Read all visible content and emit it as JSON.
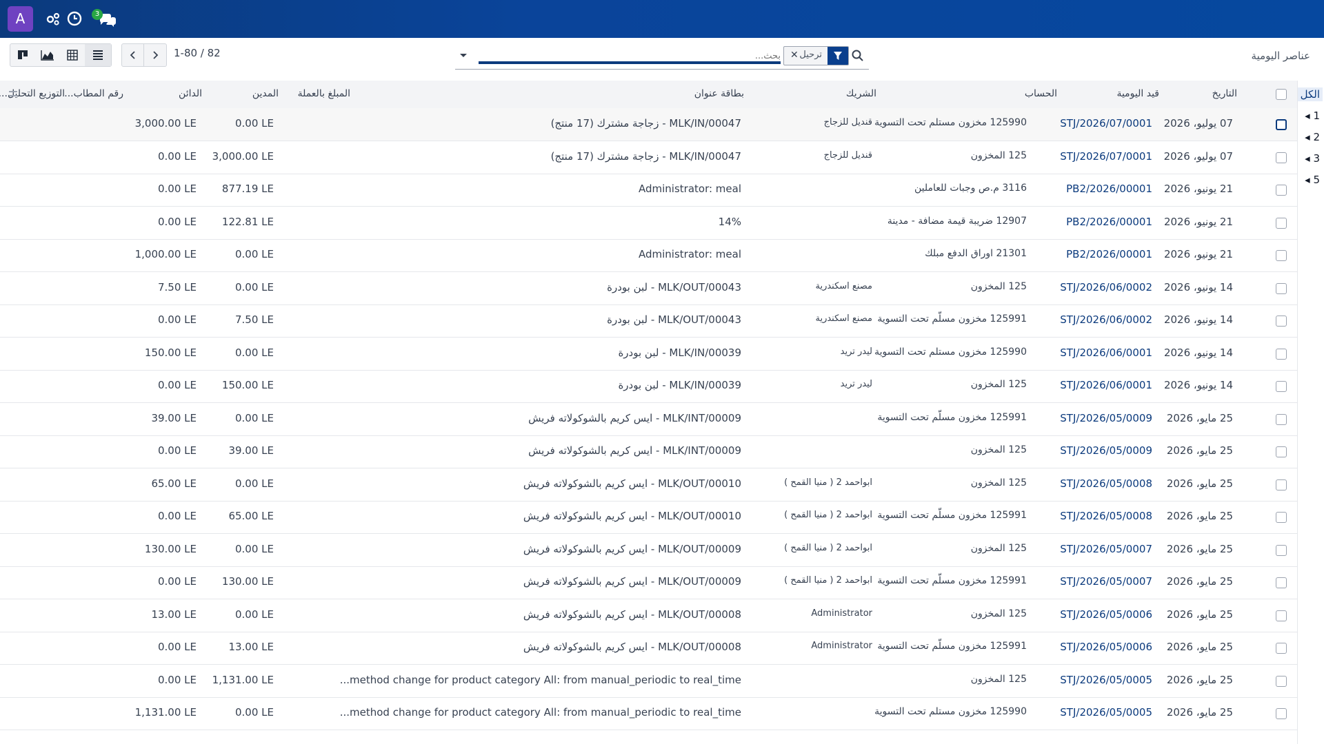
{
  "navbar": {
    "avatar_letter": "A",
    "icons": [
      "users-cog-icon",
      "clock-icon",
      "chat-icon"
    ],
    "chat_badge": "3"
  },
  "breadcrumb": "عناصر اليومية",
  "search": {
    "placeholder": "بحث...",
    "facet_value": "ترحيل"
  },
  "pager": {
    "value": "1-80 / 82"
  },
  "side_panel": {
    "items": [
      "الكل",
      "1",
      "2",
      "3",
      "5"
    ]
  },
  "table": {
    "headers": {
      "date": "التاريخ",
      "journal_entry": "قيد اليومية",
      "account": "الحساب",
      "partner": "الشريك",
      "label": "بطاقة عنوان",
      "amount_currency": "المبلغ بالعملة",
      "debit": "المدين",
      "credit": "الدائن",
      "matching": "رقم المطاب...",
      "analytic": "التوزيع التحليل..."
    },
    "rows": [
      {
        "date": "07 يوليو، 2026",
        "entry": "STJ/2026/07/0001",
        "account": "125990 مخزون مستلم تحت التسوية",
        "partner": "قنديل للزجاج",
        "label": "MLK/IN/00047 - زجاجة مشترك (17 منتج)",
        "debit": "0.00 LE",
        "credit": "3,000.00 LE"
      },
      {
        "date": "07 يوليو، 2026",
        "entry": "STJ/2026/07/0001",
        "account": "125 المخزون",
        "partner": "قنديل للزجاج",
        "label": "MLK/IN/00047 - زجاجة مشترك (17 منتج)",
        "debit": "3,000.00 LE",
        "credit": "0.00 LE"
      },
      {
        "date": "21 يونيو، 2026",
        "entry": "PB2/2026/00001",
        "account": "3116 م.ص وجبات للعاملين",
        "partner": "",
        "label": "Administrator: meal",
        "debit": "877.19 LE",
        "credit": "0.00 LE"
      },
      {
        "date": "21 يونيو، 2026",
        "entry": "PB2/2026/00001",
        "account": "12907 ضريبة قيمة مضافة - مدينة",
        "partner": "",
        "label": "14%",
        "debit": "122.81 LE",
        "credit": "0.00 LE"
      },
      {
        "date": "21 يونيو، 2026",
        "entry": "PB2/2026/00001",
        "account": "21301 اوراق الدفع مبلك",
        "partner": "",
        "label": "Administrator: meal",
        "debit": "0.00 LE",
        "credit": "1,000.00 LE"
      },
      {
        "date": "14 يونيو، 2026",
        "entry": "STJ/2026/06/0002",
        "account": "125 المخزون",
        "partner": "مصنع اسكندرية",
        "label": "MLK/OUT/00043 - لبن بودرة",
        "debit": "0.00 LE",
        "credit": "7.50 LE"
      },
      {
        "date": "14 يونيو، 2026",
        "entry": "STJ/2026/06/0002",
        "account": "125991 مخزون مسلّم تحت التسوية",
        "partner": "مصنع اسكندرية",
        "label": "MLK/OUT/00043 - لبن بودرة",
        "debit": "7.50 LE",
        "credit": "0.00 LE"
      },
      {
        "date": "14 يونيو، 2026",
        "entry": "STJ/2026/06/0001",
        "account": "125990 مخزون مستلم تحت التسوية",
        "partner": "ليدر تريد",
        "label": "MLK/IN/00039 - لبن بودرة",
        "debit": "0.00 LE",
        "credit": "150.00 LE"
      },
      {
        "date": "14 يونيو، 2026",
        "entry": "STJ/2026/06/0001",
        "account": "125 المخزون",
        "partner": "ليدر تريد",
        "label": "MLK/IN/00039 - لبن بودرة",
        "debit": "150.00 LE",
        "credit": "0.00 LE"
      },
      {
        "date": "25 مايو، 2026",
        "entry": "STJ/2026/05/0009",
        "account": "125991 مخزون مسلّم تحت التسوية",
        "partner": "",
        "label": "MLK/INT/00009 - ايس كريم بالشوكولاته فريش",
        "debit": "0.00 LE",
        "credit": "39.00 LE"
      },
      {
        "date": "25 مايو، 2026",
        "entry": "STJ/2026/05/0009",
        "account": "125 المخزون",
        "partner": "",
        "label": "MLK/INT/00009 - ايس كريم بالشوكولاته فريش",
        "debit": "39.00 LE",
        "credit": "0.00 LE"
      },
      {
        "date": "25 مايو، 2026",
        "entry": "STJ/2026/05/0008",
        "account": "125 المخزون",
        "partner": "ابواحمد 2 ( منيا القمح )",
        "label": "MLK/OUT/00010 - ايس كريم بالشوكولاته فريش",
        "debit": "0.00 LE",
        "credit": "65.00 LE"
      },
      {
        "date": "25 مايو، 2026",
        "entry": "STJ/2026/05/0008",
        "account": "125991 مخزون مسلّم تحت التسوية",
        "partner": "ابواحمد 2 ( منيا القمح )",
        "label": "MLK/OUT/00010 - ايس كريم بالشوكولاته فريش",
        "debit": "65.00 LE",
        "credit": "0.00 LE"
      },
      {
        "date": "25 مايو، 2026",
        "entry": "STJ/2026/05/0007",
        "account": "125 المخزون",
        "partner": "ابواحمد 2 ( منيا القمح )",
        "label": "MLK/OUT/00009 - ايس كريم بالشوكولاته فريش",
        "debit": "0.00 LE",
        "credit": "130.00 LE"
      },
      {
        "date": "25 مايو، 2026",
        "entry": "STJ/2026/05/0007",
        "account": "125991 مخزون مسلّم تحت التسوية",
        "partner": "ابواحمد 2 ( منيا القمح )",
        "label": "MLK/OUT/00009 - ايس كريم بالشوكولاته فريش",
        "debit": "130.00 LE",
        "credit": "0.00 LE"
      },
      {
        "date": "25 مايو، 2026",
        "entry": "STJ/2026/05/0006",
        "account": "125 المخزون",
        "partner": "Administrator",
        "label": "MLK/OUT/00008 - ايس كريم بالشوكولاته فريش",
        "debit": "0.00 LE",
        "credit": "13.00 LE"
      },
      {
        "date": "25 مايو، 2026",
        "entry": "STJ/2026/05/0006",
        "account": "125991 مخزون مسلّم تحت التسوية",
        "partner": "Administrator",
        "label": "MLK/OUT/00008 - ايس كريم بالشوكولاته فريش",
        "debit": "13.00 LE",
        "credit": "0.00 LE"
      },
      {
        "date": "25 مايو، 2026",
        "entry": "STJ/2026/05/0005",
        "account": "125 المخزون",
        "partner": "",
        "label": "method change for product category All: from manual_periodic to real_time...",
        "debit": "1,131.00 LE",
        "credit": "0.00 LE"
      },
      {
        "date": "25 مايو، 2026",
        "entry": "STJ/2026/05/0005",
        "account": "125990 مخزون مستلم تحت التسوية",
        "partner": "",
        "label": "method change for product category All: from manual_periodic to real_time...",
        "debit": "0.00 LE",
        "credit": "1,131.00 LE"
      }
    ]
  }
}
